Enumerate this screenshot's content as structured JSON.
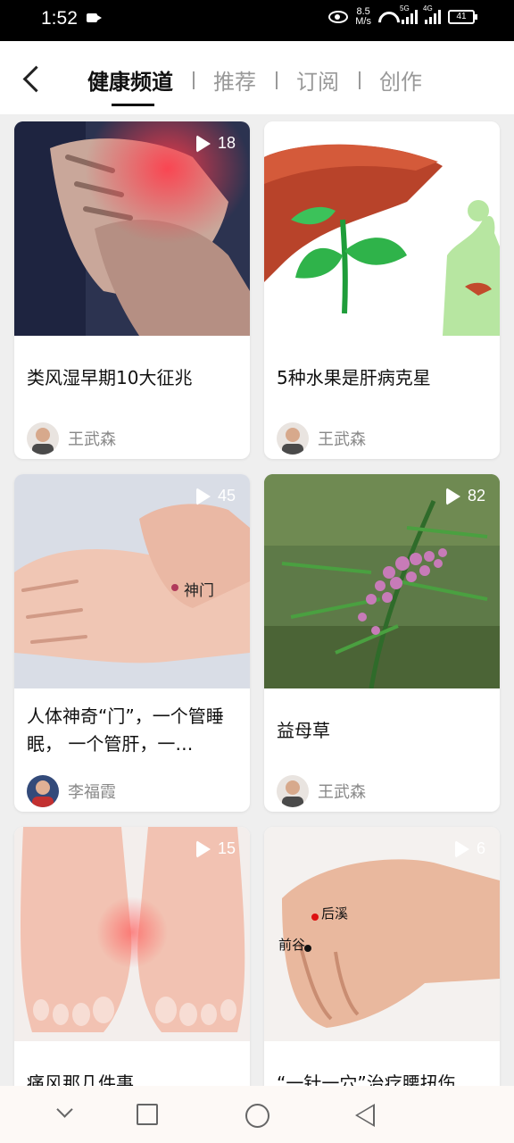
{
  "status": {
    "time": "1:52",
    "speed_value": "8.5",
    "speed_unit": "M/s",
    "signal1_label": "5G",
    "signal2_label": "4G",
    "battery": "41"
  },
  "nav": {
    "tabs": [
      "健康频道",
      "推荐",
      "订阅",
      "创作"
    ],
    "active_tab": 0
  },
  "cards": [
    {
      "title": "类风湿早期10大征兆",
      "author": "王武森",
      "plays": "18"
    },
    {
      "title": "5种水果是肝病克星",
      "author": "王武森",
      "plays": ""
    },
    {
      "title": "人体神奇“门”，一个管睡眠， 一个管肝，一…",
      "author": "李福霞",
      "plays": "45",
      "image_label": "神门"
    },
    {
      "title": "益母草",
      "author": "王武森",
      "plays": "82"
    },
    {
      "title": "痛风那几件事",
      "author": "",
      "plays": "15"
    },
    {
      "title": "“一针一穴”治疗腰扭伤",
      "author": "",
      "plays": "6",
      "image_labels": [
        "后溪",
        "前谷"
      ]
    }
  ]
}
